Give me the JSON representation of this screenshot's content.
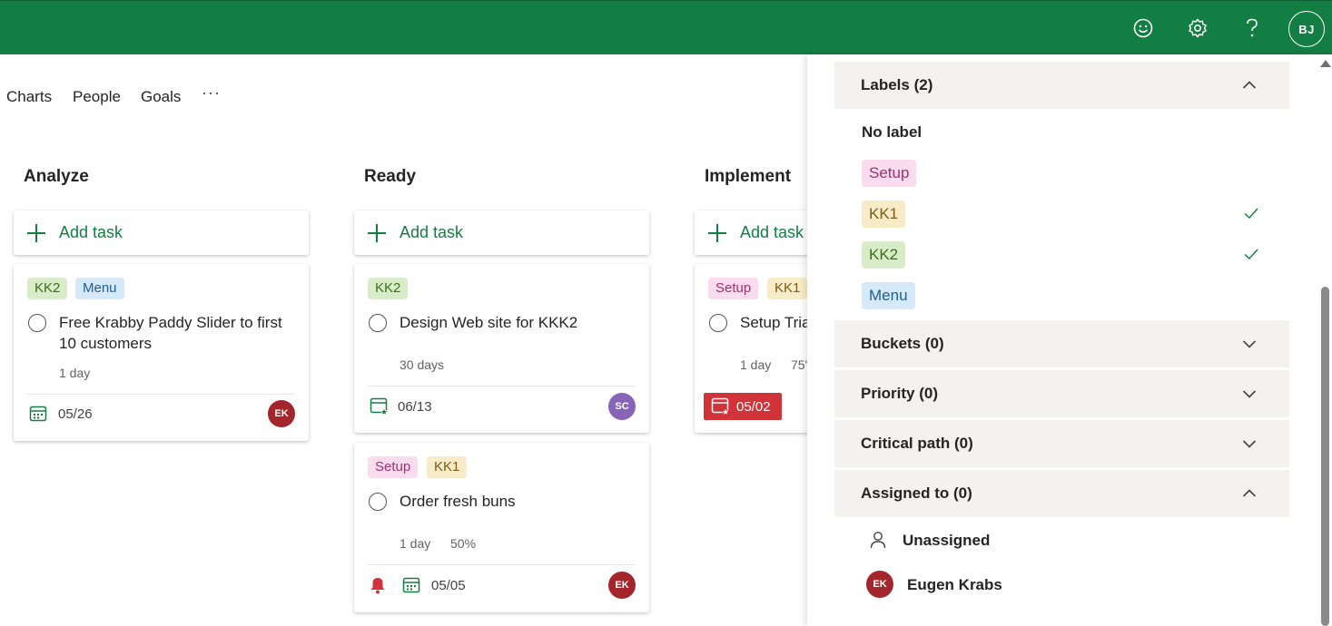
{
  "header": {
    "avatar_initials": "BJ",
    "icons": [
      "smiley-icon",
      "settings-icon",
      "help-icon"
    ],
    "brand_color": "#137e43"
  },
  "nav": {
    "tabs": [
      "Charts",
      "People",
      "Goals"
    ],
    "more": "···"
  },
  "board": {
    "add_task_label": "Add task",
    "buckets": [
      {
        "title": "Analyze",
        "tasks": [
          {
            "labels": [
              "KK2",
              "Menu"
            ],
            "title": "Free Krabby Paddy Slider to first 10 customers",
            "duration": "1 day",
            "due": "05/26",
            "assignee": "EK"
          }
        ]
      },
      {
        "title": "Ready",
        "tasks": [
          {
            "labels": [
              "KK2"
            ],
            "title": "Design Web site for KKK2",
            "duration": "30 days",
            "due": "06/13",
            "assignee": "SC"
          },
          {
            "labels": [
              "Setup",
              "KK1"
            ],
            "title": "Order fresh buns",
            "duration": "1 day",
            "progress": "50%",
            "due": "05/05",
            "assignee": "EK"
          }
        ]
      },
      {
        "title": "Implement",
        "tasks": [
          {
            "labels": [
              "Setup",
              "KK1"
            ],
            "title": "Setup Tria",
            "duration": "1 day",
            "progress": "75'",
            "due": "05/02",
            "late": true
          }
        ]
      }
    ]
  },
  "filter_panel": {
    "labels_header": "Labels (2)",
    "label_options": [
      {
        "text": "No label",
        "selected": false
      },
      {
        "text": "Setup",
        "selected": false
      },
      {
        "text": "KK1",
        "selected": true
      },
      {
        "text": "KK2",
        "selected": true
      },
      {
        "text": "Menu",
        "selected": false
      }
    ],
    "sections": [
      "Buckets (0)",
      "Priority (0)",
      "Critical path (0)"
    ],
    "assigned_header": "Assigned to (0)",
    "assignees": [
      {
        "text": "Unassigned"
      },
      {
        "text": "Eugen Krabs",
        "initials": "EK"
      }
    ]
  }
}
